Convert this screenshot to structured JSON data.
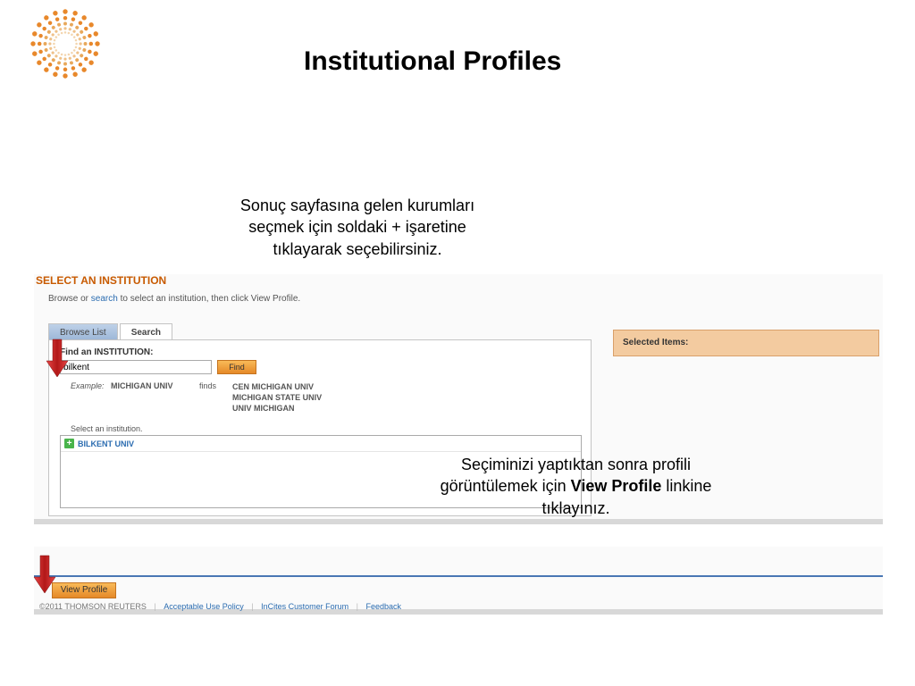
{
  "title": "Institutional Profiles",
  "caption1_l1": "Sonuç sayfasına gelen kurumları",
  "caption1_l2": "seçmek için soldaki + işaretine",
  "caption1_l3": "tıklayarak seçebilirsiniz.",
  "caption2_plain1": "Seçiminizi yaptıktan sonra profili",
  "caption2_plain2": "görüntülemek için ",
  "caption2_bold": "View Profile",
  "caption2_plain3": " linkine",
  "caption2_l3": "tıklayınız.",
  "ui": {
    "select_heading": "SELECT AN INSTITUTION",
    "sub_pre": "Browse or ",
    "sub_link": "search",
    "sub_post": " to select an institution, then click View Profile.",
    "tab_browse": "Browse List",
    "tab_search": "Search",
    "find_label": "Find an INSTITUTION:",
    "search_value": "bilkent",
    "find_btn": "Find",
    "example_label": "Example:",
    "example_term": "MICHIGAN UNIV",
    "example_finds": "finds",
    "example_res1": "CEN MICHIGAN UNIV",
    "example_res2": "MICHIGAN STATE UNIV",
    "example_res3": "UNIV MICHIGAN",
    "select_instr": "Select an institution.",
    "result1": "BILKENT UNIV",
    "selected_label": "Selected Items:",
    "view_profile": "View Profile",
    "footer_copy": "©2011 THOMSON REUTERS",
    "footer_aup": "Acceptable Use Policy",
    "footer_forum": "InCites Customer Forum",
    "footer_feedback": "Feedback"
  }
}
